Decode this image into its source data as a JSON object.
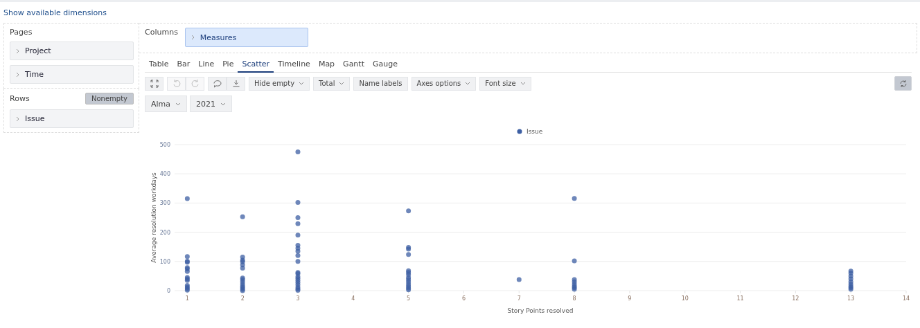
{
  "link": "Show available dimensions",
  "pages": {
    "title": "Pages",
    "items": [
      {
        "label": "Project"
      },
      {
        "label": "Time"
      }
    ]
  },
  "rows": {
    "title": "Rows",
    "nonempty": {
      "label": "Nonempty",
      "selected": true
    },
    "items": [
      {
        "label": "Issue"
      }
    ]
  },
  "columns": {
    "title": "Columns",
    "items": [
      {
        "label": "Measures"
      }
    ]
  },
  "tabs": [
    {
      "label": "Table",
      "selected": false
    },
    {
      "label": "Bar",
      "selected": false
    },
    {
      "label": "Line",
      "selected": false
    },
    {
      "label": "Pie",
      "selected": false
    },
    {
      "label": "Scatter",
      "selected": true
    },
    {
      "label": "Timeline",
      "selected": false
    },
    {
      "label": "Map",
      "selected": false
    },
    {
      "label": "Gantt",
      "selected": false
    },
    {
      "label": "Gauge",
      "selected": false
    }
  ],
  "toolbar": {
    "icon_buttons": [
      {
        "disabled": false
      },
      {
        "disabled": true
      },
      {
        "disabled": true
      },
      {
        "disabled": false
      },
      {
        "disabled": false
      }
    ],
    "options": [
      {
        "label": "Hide empty",
        "dropdown": true
      },
      {
        "label": "Total",
        "dropdown": true
      },
      {
        "label": "Name labels",
        "dropdown": false
      },
      {
        "label": "Axes options",
        "dropdown": true
      },
      {
        "label": "Font size",
        "dropdown": true
      }
    ],
    "refresh": {
      "selected": true
    }
  },
  "filters": [
    {
      "label": "Alma"
    },
    {
      "label": "2021"
    }
  ],
  "chart": {
    "chart_data": {
      "type": "scatter",
      "grid": true,
      "xlabel": "Story Points resolved",
      "ylabel": "Average resolution workdays",
      "xlim": [
        0.77,
        14
      ],
      "ylim": [
        0,
        500
      ],
      "xticks": [
        1,
        2,
        3,
        4,
        5,
        6,
        7,
        8,
        9,
        10,
        11,
        12,
        13,
        14
      ],
      "yticks": [
        0,
        100,
        200,
        300,
        400,
        500
      ],
      "series": [
        {
          "name": "Issue",
          "color": "#3d5fa3",
          "x": [
            1,
            1,
            1,
            1,
            1,
            1,
            1,
            1,
            1,
            1,
            1,
            1,
            1,
            1,
            2,
            2,
            2,
            2,
            2,
            2,
            2,
            2,
            2,
            2,
            2,
            2,
            2,
            2,
            3,
            3,
            3,
            3,
            3,
            3,
            3,
            3,
            3,
            3,
            3,
            3,
            3,
            3,
            3,
            3,
            3,
            3,
            3,
            3,
            5,
            5,
            5,
            5,
            5,
            5,
            5,
            5,
            5,
            5,
            5,
            5,
            5,
            5,
            7,
            8,
            8,
            8,
            8,
            8,
            8,
            8,
            8,
            13,
            13,
            13,
            13,
            13,
            13,
            13,
            13,
            13
          ],
          "values": [
            315,
            117,
            101,
            97,
            79,
            74,
            66,
            45,
            40,
            35,
            18,
            12,
            7,
            2,
            253,
            115,
            104,
            99,
            88,
            77,
            43,
            38,
            30,
            22,
            15,
            10,
            5,
            0,
            475,
            302,
            250,
            229,
            190,
            155,
            145,
            135,
            120,
            100,
            62,
            58,
            48,
            42,
            35,
            28,
            20,
            12,
            6,
            1,
            273,
            148,
            142,
            124,
            68,
            62,
            55,
            45,
            38,
            30,
            22,
            15,
            9,
            3,
            38,
            316,
            102,
            38,
            30,
            22,
            15,
            10,
            5,
            67,
            60,
            50,
            40,
            30,
            22,
            15,
            10,
            5
          ]
        }
      ]
    }
  }
}
